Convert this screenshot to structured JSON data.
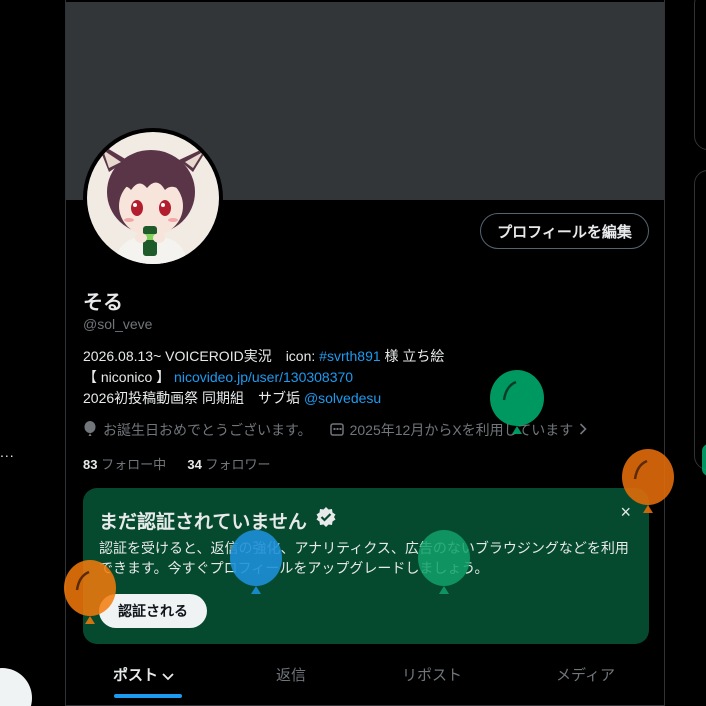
{
  "left": {
    "more_dots": "..."
  },
  "profile": {
    "edit_button": "プロフィールを編集",
    "display_name": "そる",
    "handle": "@sol_veve",
    "bio": {
      "line1_prefix": "2026.08.13~ VOICEROID実況　icon: ",
      "line1_hashtag": "#svrth891",
      "line1_suffix": " 様 立ち絵",
      "line2_prefix": "【 niconico 】",
      "line2_link": "nicovideo.jp/user/130308370",
      "line3_prefix": "2026初投稿動画祭 同期組　サブ垢 ",
      "line3_mention": "@solvedesu"
    },
    "birthday_text": "お誕生日おめでとうございます。",
    "joined_text": "2025年12月からXを利用しています",
    "following_count": "83",
    "following_label": "フォロー中",
    "followers_count": "34",
    "followers_label": "フォロワー"
  },
  "verify_card": {
    "title": "まだ認証されていません",
    "close": "×",
    "description": "認証を受けると、返信の強化、アナリティクス、広告のないブラウジングなどを利用できます。今すぐプロフィールをアップグレードしましょう。",
    "button": "認証される"
  },
  "tabs": {
    "posts": "ポスト",
    "replies": "返信",
    "reposts": "リポスト",
    "media": "メディア"
  },
  "colors": {
    "accent": "#1d9bf0",
    "card_bg": "#054a2e",
    "balloon_green": "#00a86b",
    "balloon_orange": "#f47a0b",
    "balloon_blue": "#1d8fd8"
  }
}
